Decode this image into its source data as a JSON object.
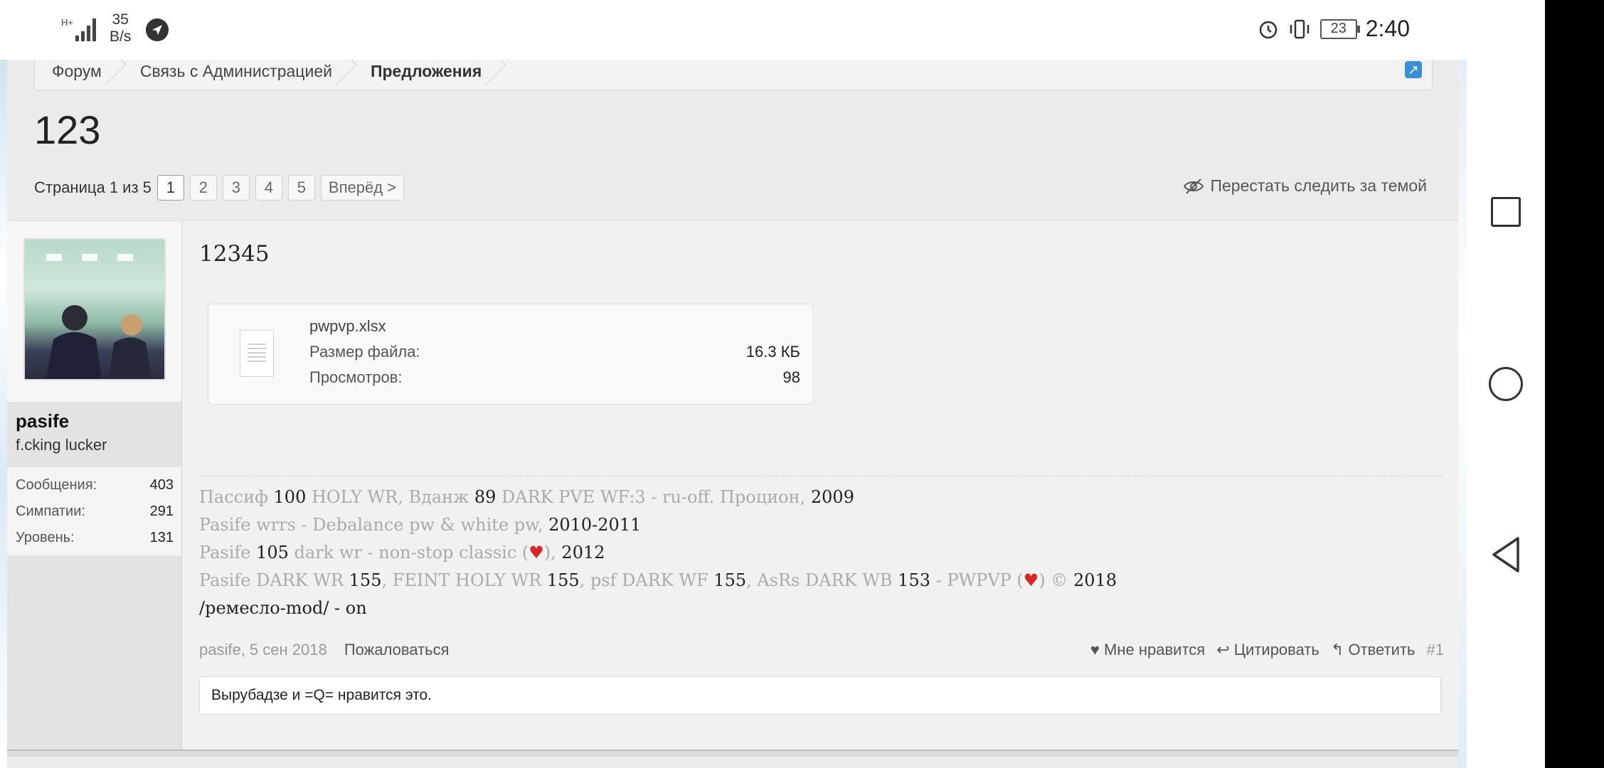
{
  "status_bar": {
    "network_type": "H+",
    "net_speed_value": "35",
    "net_speed_unit": "B/s",
    "battery": "23",
    "time": "2:40"
  },
  "breadcrumb": [
    "Форум",
    "Связь с Администрацией",
    "Предложения"
  ],
  "thread": {
    "title": "123",
    "pagination": {
      "label": "Страница 1 из 5",
      "pages": [
        "1",
        "2",
        "3",
        "4",
        "5"
      ],
      "current": "1",
      "next": "Вперёд >"
    },
    "unwatch": "Перестать следить за темой"
  },
  "post": {
    "author": {
      "name": "pasife",
      "title": "f.cking lucker",
      "stats": [
        {
          "label": "Сообщения:",
          "value": "403"
        },
        {
          "label": "Симпатии:",
          "value": "291"
        },
        {
          "label": "Уровень:",
          "value": "131"
        }
      ]
    },
    "text": "12345",
    "attachment": {
      "filename": "pwpvp.xlsx",
      "size_label": "Размер файла:",
      "size_value": "16.3 КБ",
      "views_label": "Просмотров:",
      "views_value": "98"
    },
    "signature": {
      "line1": [
        {
          "t": "Пассиф ",
          "d": false
        },
        {
          "t": "100",
          "d": true
        },
        {
          "t": " HOLY WR, Вданж ",
          "d": false
        },
        {
          "t": "89",
          "d": true
        },
        {
          "t": " DARK PVE WF:3 - ru-off. Процион, ",
          "d": false
        },
        {
          "t": "2009",
          "d": true
        }
      ],
      "line2": [
        {
          "t": "Pasife wrrs - Debalance pw & white pw, ",
          "d": false
        },
        {
          "t": "2010-2011",
          "d": true
        }
      ],
      "line3": [
        {
          "t": "Pasife ",
          "d": false
        },
        {
          "t": "105",
          "d": true
        },
        {
          "t": " dark wr - non-stop classic (",
          "d": false
        },
        {
          "t": "♥",
          "h": true
        },
        {
          "t": "), ",
          "d": false
        },
        {
          "t": "2012",
          "d": true
        }
      ],
      "line4": [
        {
          "t": "Pasife DARK WR ",
          "d": false
        },
        {
          "t": "155",
          "d": true
        },
        {
          "t": ", FEINT HOLY WR ",
          "d": false
        },
        {
          "t": "155",
          "d": true
        },
        {
          "t": ", psf DARK WF ",
          "d": false
        },
        {
          "t": "155",
          "d": true
        },
        {
          "t": ", AsRs DARK WB ",
          "d": false
        },
        {
          "t": "153",
          "d": true
        },
        {
          "t": " - PWPVP (",
          "d": false
        },
        {
          "t": "♥",
          "h": true
        },
        {
          "t": ") © ",
          "d": false
        },
        {
          "t": "2018",
          "d": true
        }
      ],
      "line5": [
        {
          "t": "/ремесло-mod/ - on",
          "d": true
        }
      ]
    },
    "footer": {
      "meta": "pasife, 5 сен 2018",
      "report": "Пожаловаться",
      "like": "Мне нравится",
      "quote": "Цитировать",
      "reply": "Ответить",
      "number": "#1"
    },
    "likes_text": "Вырубадзе и =Q= нравится это."
  },
  "icons": {
    "external_link": "external-link-icon",
    "unwatch": "eye-slash-icon",
    "like": "heart-icon",
    "quote": "reply-all-icon",
    "reply": "reply-icon"
  },
  "colors": {
    "heart": "#d62828",
    "link_blue": "#3b8fd6"
  }
}
